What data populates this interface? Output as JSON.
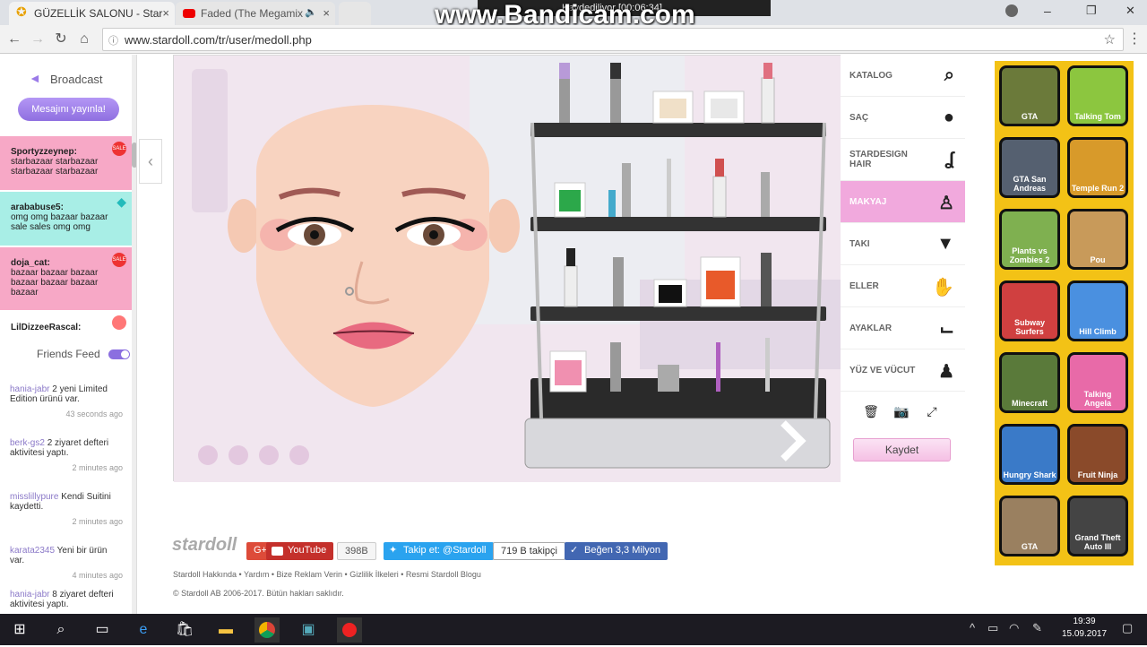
{
  "browser": {
    "tabs": [
      {
        "label": "GÜZELLİK SALONU - Star",
        "close": "×"
      },
      {
        "label": "Faded (The Megamix",
        "close": "×"
      }
    ],
    "url": "www.stardoll.com/tr/user/medoll.php",
    "window_controls": [
      "–",
      "❐",
      "✕"
    ]
  },
  "overlay": {
    "watermark": "www.Bandicam.com",
    "recording_status": "Kaydediliyor [00:06:34]"
  },
  "left_panel": {
    "broadcast_label": "Broadcast",
    "publish_button": "Mesajını yayınla!",
    "posts": [
      {
        "user": "Sportyzzeynep:",
        "text": "starbazaar starbazaar starbazaar starbazaar",
        "color": "#f7a8c6"
      },
      {
        "user": "arababuse5:",
        "text": "omg omg bazaar bazaar sale sales omg omg",
        "color": "#a8eee6"
      },
      {
        "user": "doja_cat:",
        "text": "bazaar bazaar bazaar bazaar bazaar bazaar bazaar",
        "color": "#f7a8c6"
      },
      {
        "user": "LilDizzeeRascal:",
        "text": "",
        "color": "#ffffff"
      }
    ],
    "friends_feed_label": "Friends Feed",
    "feed": [
      {
        "user": "hania-jabr",
        "text": "2 yeni Limited Edition ürünü var.",
        "time": "43 seconds ago"
      },
      {
        "user": "berk-gs2",
        "text": "2 ziyaret defteri aktivitesi yaptı.",
        "time": "2 minutes ago"
      },
      {
        "user": "misslillypure",
        "text": "Kendi Suitini kaydetti.",
        "time": "2 minutes ago"
      },
      {
        "user": "karata2345",
        "text": "Yeni bir ürün var.",
        "time": "4 minutes ago"
      },
      {
        "user": "hania-jabr",
        "text": "8 ziyaret defteri aktivitesi yaptı.",
        "time": ""
      }
    ]
  },
  "menu": {
    "items": [
      {
        "label": "KATALOG",
        "icon": "magnifier-icon"
      },
      {
        "label": "SAÇ",
        "icon": "hair-icon"
      },
      {
        "label": "STARDESIGN HAIR",
        "icon": "seahorse-icon"
      },
      {
        "label": "MAKYAJ",
        "icon": "lipstick-icon",
        "active": true
      },
      {
        "label": "TAKI",
        "icon": "jewelry-icon"
      },
      {
        "label": "ELLER",
        "icon": "hand-icon"
      },
      {
        "label": "AYAKLAR",
        "icon": "foot-icon"
      },
      {
        "label": "YÜZ VE VÜCUT",
        "icon": "body-icon"
      }
    ],
    "save_button": "Kaydet"
  },
  "footer": {
    "logo": "stardoll",
    "youtube": "YouTube",
    "youtube_count": "398B",
    "twitter": "Takip et: @Stardoll",
    "twitter_count": "719 B takipçi",
    "facebook": "Beğen 3,3 Milyon",
    "google": "G+",
    "links": "Stardoll Hakkında • Yardım • Bize Reklam Verin • Gizlilik İlkeleri • Resmi Stardoll Blogu",
    "copyright": "© Stardoll AB 2006-2017. Bütün hakları saklıdır."
  },
  "games": [
    {
      "label": "GTA",
      "color": "#6b7a3a"
    },
    {
      "label": "Talking Tom",
      "color": "#8cc63f"
    },
    {
      "label": "GTA San Andreas",
      "color": "#556070"
    },
    {
      "label": "Temple Run 2",
      "color": "#d89a2a"
    },
    {
      "label": "Plants vs Zombies 2",
      "color": "#7fb050"
    },
    {
      "label": "Pou",
      "color": "#c89a5a"
    },
    {
      "label": "Subway Surfers",
      "color": "#d04040"
    },
    {
      "label": "Hill Climb",
      "color": "#4a90e0"
    },
    {
      "label": "Minecraft",
      "color": "#5a7a3a"
    },
    {
      "label": "Talking Angela",
      "color": "#e86aa8"
    },
    {
      "label": "Hungry Shark",
      "color": "#3a7ac8"
    },
    {
      "label": "Fruit Ninja",
      "color": "#8a4a2a"
    },
    {
      "label": "GTA",
      "color": "#9a8060"
    },
    {
      "label": "Grand Theft Auto III",
      "color": "#444444"
    }
  ],
  "taskbar": {
    "time": "19:39",
    "date": "15.09.2017"
  }
}
